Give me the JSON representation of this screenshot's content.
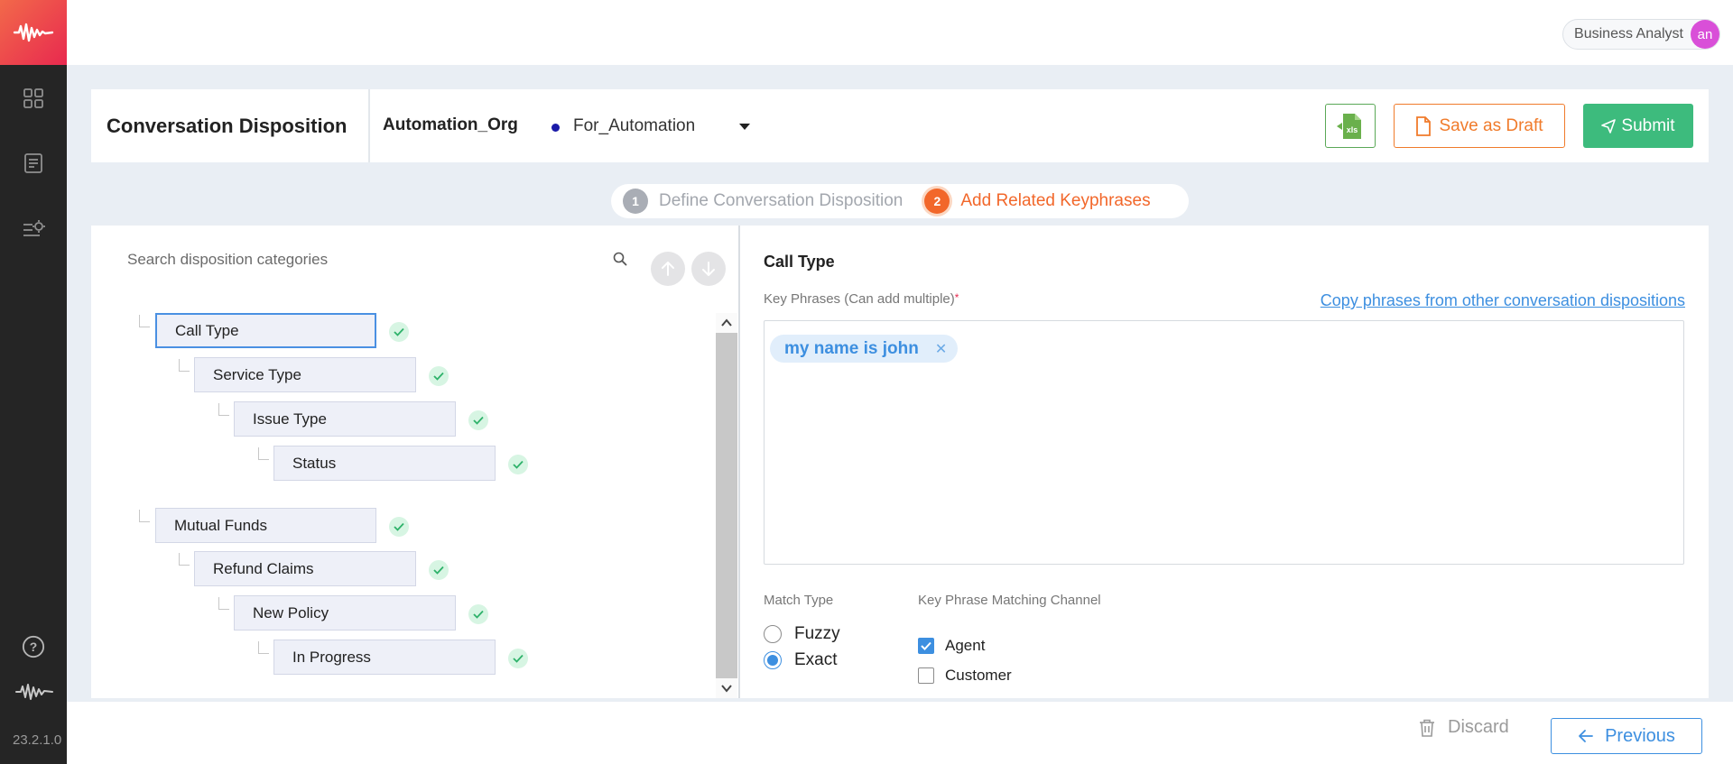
{
  "app": {
    "version": "23.2.1.0",
    "logo": "waveform-logo"
  },
  "nav": {
    "icons": [
      "dashboard-grid-icon",
      "document-list-icon",
      "settings-list-icon",
      "help-icon",
      "waveform-icon"
    ]
  },
  "user": {
    "role": "Business Analyst",
    "initials": "an",
    "avatar_color": "#d94fd8"
  },
  "header": {
    "title": "Conversation Disposition",
    "org": "Automation_Org",
    "project": "For_Automation",
    "project_dot_color": "#1a1aa8",
    "export_icon": "xls-file-icon",
    "save_draft_label": "Save as Draft",
    "submit_label": "Submit"
  },
  "stepper": {
    "steps": [
      {
        "num": "1",
        "label": "Define Conversation Disposition",
        "state": "done"
      },
      {
        "num": "2",
        "label": "Add Related Keyphrases",
        "state": "active"
      }
    ]
  },
  "tree": {
    "search_placeholder": "Search disposition categories",
    "nodes": [
      {
        "label": "Call Type",
        "level": 0,
        "selected": true,
        "verified": true
      },
      {
        "label": "Service Type",
        "level": 1,
        "verified": true
      },
      {
        "label": "Issue Type",
        "level": 2,
        "verified": true
      },
      {
        "label": "Status",
        "level": 3,
        "verified": true
      },
      {
        "label": "Mutual Funds",
        "level": 0,
        "verified": true
      },
      {
        "label": "Refund Claims",
        "level": 1,
        "verified": true
      },
      {
        "label": "New Policy",
        "level": 2,
        "verified": true
      },
      {
        "label": "In Progress",
        "level": 3,
        "verified": true
      }
    ]
  },
  "detail": {
    "title": "Call Type",
    "key_phrases_label": "Key Phrases (Can add multiple)",
    "required_mark": "*",
    "copy_link": "Copy phrases from other conversation dispositions",
    "phrases": [
      "my name is john"
    ],
    "match_type_label": "Match Type",
    "match_types": [
      {
        "label": "Fuzzy",
        "selected": false
      },
      {
        "label": "Exact",
        "selected": true
      }
    ],
    "channel_label": "Key Phrase Matching Channel",
    "channels": [
      {
        "label": "Agent",
        "checked": true
      },
      {
        "label": "Customer",
        "checked": false
      }
    ]
  },
  "footer": {
    "discard_label": "Discard",
    "previous_label": "Previous"
  },
  "colors": {
    "accent_orange": "#f2672a",
    "accent_blue": "#3d8fe0",
    "submit_green": "#3dbb7d"
  }
}
